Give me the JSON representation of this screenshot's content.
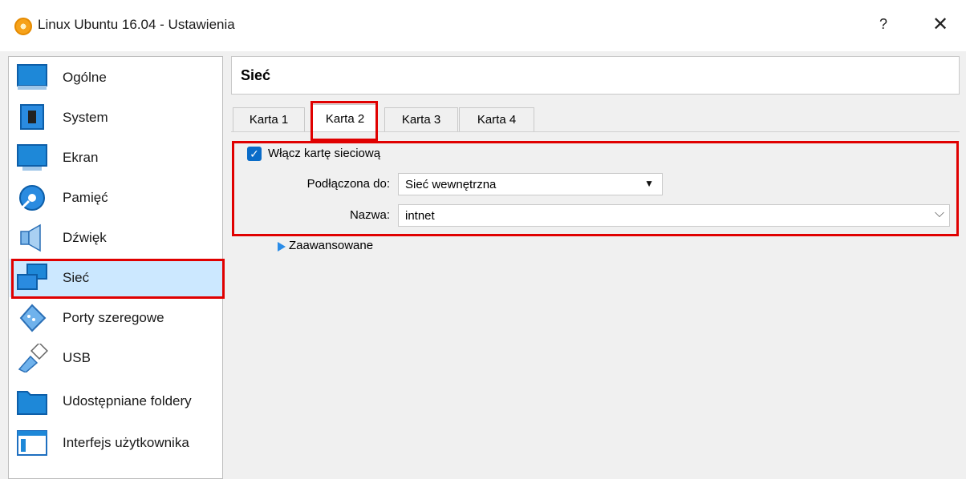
{
  "window": {
    "title": "Linux Ubuntu 16.04 - Ustawienia",
    "help": "?",
    "close": "✕"
  },
  "sidebar": {
    "items": [
      {
        "label": "Ogólne",
        "icon": "general-monitor-icon"
      },
      {
        "label": "System",
        "icon": "chip-icon"
      },
      {
        "label": "Ekran",
        "icon": "display-icon"
      },
      {
        "label": "Pamięć",
        "icon": "storage-disk-icon"
      },
      {
        "label": "Dźwięk",
        "icon": "speaker-icon"
      },
      {
        "label": "Sieć",
        "icon": "network-icon",
        "selected": true
      },
      {
        "label": "Porty szeregowe",
        "icon": "serial-port-icon"
      },
      {
        "label": "USB",
        "icon": "usb-icon"
      },
      {
        "label": "Udostępniane foldery",
        "icon": "folder-icon"
      },
      {
        "label": "Interfejs użytkownika",
        "icon": "ui-window-icon"
      }
    ]
  },
  "panel": {
    "title": "Sieć",
    "tabs": [
      {
        "label": "Karta 1"
      },
      {
        "label": "Karta 2",
        "active": true
      },
      {
        "label": "Karta 3"
      },
      {
        "label": "Karta 4"
      }
    ],
    "enable_label": "Włącz kartę sieciową",
    "enable_checked": true,
    "attached_label": "Podłączona do:",
    "attached_value": "Sieć wewnętrzna",
    "name_label": "Nazwa:",
    "name_value": "intnet",
    "advanced_label": "Zaawansowane"
  },
  "colors": {
    "highlight": "#e00000",
    "selection": "#cce8ff",
    "accent": "#0a6cc8"
  }
}
